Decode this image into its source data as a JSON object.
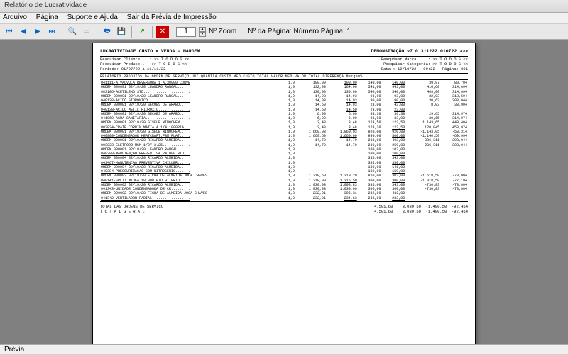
{
  "window": {
    "title": "Relatório de Lucratividade"
  },
  "menu": {
    "items": [
      "Arquivo",
      "Página",
      "Suporte e Ajuda",
      "Sair da Prévia de Impressão"
    ]
  },
  "toolbar": {
    "zoom_value": "1",
    "zoom_label": "Nº Zoom",
    "page_label": "Nº da Página: Número Página: 1"
  },
  "status": {
    "text": "Prévia"
  },
  "report": {
    "title_left": "LUCRATIVIDADE  CUSTO x VENDA = MARGEM",
    "title_right": "DEMONSTRAÇÃO v7.0 311222 010722 >>>",
    "filter_client_lbl": "Pesquisar Cliente... : >> T O D O S <<",
    "filter_prod_lbl": "Pesquisar Produto.. : >> T O D O S <<",
    "filter_marca_lbl": "Pesquisar Marca.... : >> T O D O S <<",
    "filter_cat_lbl": "Pesquisar Categoria: >> T O D O S <<",
    "period": "Período: 01/07/22 à 11/11/22",
    "printed": "Data : 12/10/22 - 09:22",
    "page": "Página: 001",
    "col_header": "RELATÓRIO PRODUTOS DA ORDEM DE SERVIÇO   UNI QUANTIA CUSTO MED  CUSTO TOTAL VALOR MED   VALOR TOTAL  DIFERENÇA Margem%",
    "rows": [
      {
        "t": "i",
        "c": "041111-A VALVULA REVERSORA 1 A.30000 CONVE",
        "u": "1,0",
        "q": "100,00",
        "cm": "100,00",
        "ct": "140,00",
        "vm": "",
        "vt": "140,00",
        "d": "39,97",
        "m": "80,704"
      },
      {
        "t": "o",
        "c": "ORDEM  000001  02/19/20  LEANDRO RANGAL",
        "u": "1,0",
        "q": "132,00",
        "cm": "164,00",
        "ct": "541,00",
        "vm": "",
        "vt": "941,00",
        "d": "416,60",
        "m": "314,094"
      },
      {
        "t": "i",
        "c": "003186-ACETILENO STD",
        "u": "1,0",
        "q": "130,00",
        "cm": "130,00",
        "ct": "540,00",
        "vm": "",
        "vt": "540,00",
        "d": "409,00",
        "m": "314,094"
      },
      {
        "t": "o",
        "c": "ORDEM  000001  02/19/20  LEANDRO RANGAL",
        "u": "1,0",
        "q": "14,93",
        "cm": "14,93",
        "ct": "93,00",
        "vm": "",
        "vt": "93,00",
        "d": "32,93",
        "m": "313,594"
      },
      {
        "t": "i",
        "c": "040138-ACIDO SIDRONICO",
        "u": "1,0",
        "q": "14,93",
        "cm": "14,93",
        "ct": "90,00",
        "vm": "",
        "vt": "90,00",
        "d": "30,63",
        "m": "303,044"
      },
      {
        "t": "o",
        "c": "ORDEM  000001  02/19/20  SECOES DE ARABO",
        "u": "1,0",
        "q": "14,50",
        "cm": "14,93",
        "ct": "23,00",
        "vm": "",
        "vt": "43,00",
        "d": "8,03",
        "m": "38,904"
      },
      {
        "t": "i",
        "c": "040138-ACIDO METIL HIDROXIO",
        "u": "1,0",
        "q": "14,50",
        "cm": "14,50",
        "ct": "23,00",
        "vm": "",
        "vt": "23,00",
        "d": "",
        "m": ""
      },
      {
        "t": "o",
        "c": "ORDEM  000001  02/19/20  SECOES DE ARABO",
        "u": "1,0",
        "q": "6,00",
        "cm": "6,00",
        "ct": "33,30",
        "vm": "",
        "vt": "36,30",
        "d": "29,65",
        "m": "314,974"
      },
      {
        "t": "i",
        "c": "041069-AGUA SANITARIA",
        "u": "1,0",
        "q": "6,00",
        "cm": "6,00",
        "ct": "33,00",
        "vm": "",
        "vt": "33,00",
        "d": "30,65",
        "m": "314,974"
      },
      {
        "t": "o",
        "c": "ORDEM  000001  02/19/20  GISELE WINOCHEM",
        "u": "1,0",
        "q": "3,48",
        "cm": "3,48",
        "ct": "123,50",
        "vm": "",
        "vt": "123,50",
        "d": "1.143,65",
        "m": "449,404"
      },
      {
        "t": "i",
        "c": "003024-CRATE CORBIN MATIA A.1/4 1000P1A",
        "u": "1,0",
        "q": "3,48",
        "cm": "3,48",
        "ct": "123,30",
        "vm": "",
        "vt": "123,50",
        "d": "120,045",
        "m": "450,974"
      },
      {
        "t": "o",
        "c": "ORDEM  000001  02/19/20  GISELE WINOCHEM",
        "u": "1,0",
        "q": "1.660,03",
        "cm": "1.960,03",
        "ct": "920,00",
        "vm": "",
        "vt": "920,00",
        "d": "-1.143,05",
        "m": "-58,314"
      },
      {
        "t": "i",
        "c": "040909-CONDENSADOR HEATCRAFT.FBM FLAT.",
        "u": "1,0",
        "q": "1.660,50",
        "cm": "1.660,00",
        "ct": "930,00",
        "vm": "",
        "vt": "500,00",
        "d": "-1.140,50",
        "m": "-69,994"
      },
      {
        "t": "o",
        "c": "ORDEM  000001  02/19/20  RICARDO ALMEIDA",
        "u": "1,0",
        "q": "14,70",
        "cm": "14,70",
        "ct": "233,00",
        "vm": "",
        "vt": "403,00",
        "d": "336,311",
        "m": "303,044"
      },
      {
        "t": "i",
        "c": "003033-ELETRODO MGM 1/9\" 3.25",
        "u": "1,0",
        "q": "14,70",
        "cm": "14,70",
        "ct": "230,00",
        "vm": "",
        "vt": "250,00",
        "d": "236,311",
        "m": "303,044"
      },
      {
        "t": "o",
        "c": "ORDEM  000001  02/19/20  LEANDRO RANGAL",
        "u": "1,0",
        "q": "",
        "cm": "",
        "ct": "100,00",
        "vm": "",
        "vt": "103,00",
        "d": "",
        "m": ""
      },
      {
        "t": "i",
        "c": "040388-MANUTENÇÃO PREVENTIVA 24.000 BTU",
        "u": "1,0",
        "q": "",
        "cm": "",
        "ct": "100,00",
        "vm": "",
        "vt": "100,00",
        "d": "",
        "m": ""
      },
      {
        "t": "o",
        "c": "ORDEM  000004  02/19/20  RICARDO ALMEIDA",
        "u": "1,0",
        "q": "",
        "cm": "",
        "ct": "335,00",
        "vm": "",
        "vt": "343,00",
        "d": "",
        "m": ""
      },
      {
        "t": "i",
        "c": "043467-MANUTENÇÃO PREVENTIVA CHILLER",
        "u": "1,0",
        "q": "",
        "cm": "",
        "ct": "335,00",
        "vm": "",
        "vt": "350,00",
        "d": "",
        "m": ""
      },
      {
        "t": "o",
        "c": "ORDEM  000004  02/19/20  RICARDO ALMEIDA",
        "u": "1,0",
        "q": "",
        "cm": "",
        "ct": "130,00",
        "vm": "",
        "vt": "141,00",
        "d": "",
        "m": ""
      },
      {
        "t": "i",
        "c": "040384-PRESSURIZAÇÃO COM NITROGÊNIO",
        "u": "1,0",
        "q": "",
        "cm": "",
        "ct": "150,00",
        "vm": "",
        "vt": "150,00",
        "d": "",
        "m": ""
      },
      {
        "t": "o",
        "c": "ORDEM  000002  02/19/20  FICHA DE ALMEIDA JOCA CHAVES",
        "u": "1,0",
        "q": "1.318,50",
        "cm": "1.319,20",
        "ct": "820,00",
        "vm": "",
        "vt": "303,00",
        "d": "-1.518,50",
        "m": "-73,004"
      },
      {
        "t": "i",
        "c": "040141-SPLIT MIDEA 18.000 BTU HI FRIO",
        "u": "1,0",
        "q": "1.318,00",
        "cm": "1.315,50",
        "ct": "300,00",
        "vm": "",
        "vt": "300,00",
        "d": "-1.018,50",
        "m": "-77,194"
      },
      {
        "t": "o",
        "c": "ORDEM  000002  02/19/20  RICARDO ALMEIDA",
        "u": "1,0",
        "q": "1.030,03",
        "cm": "1.098,83",
        "ct": "335,00",
        "vm": "",
        "vt": "343,00",
        "d": "-730,83",
        "m": "-73,004"
      },
      {
        "t": "i",
        "c": "041343-UNIDADE CONDENSADORA DE CR",
        "u": "1,0",
        "q": "1.030,83",
        "cm": "1.030,00",
        "ct": "305,00",
        "vm": "",
        "vt": "300,00",
        "d": "-730,83",
        "m": "-73,004"
      },
      {
        "t": "o",
        "c": "ORDEM  000002  02/19/20  FICHA DE ALMEIDA JOCA CHAVES",
        "u": "1,0",
        "q": "232,01",
        "cm": "306,31",
        "ct": "232,00",
        "vm": "",
        "vt": "432,00",
        "d": "",
        "m": ""
      },
      {
        "t": "i",
        "c": "041342-VENTILADOR RADIAL",
        "u": "1,0",
        "q": "232,01",
        "cm": "234,63",
        "ct": "233,00",
        "vm": "",
        "vt": "233,00",
        "d": "",
        "m": ""
      }
    ],
    "totals": [
      {
        "label": "TOTAL DAS ORDENS DE SERVIÇO",
        "c1": "4.501,60",
        "c2": "3.039,50",
        "c3": "-1.490,50",
        "c4": "-92,454"
      },
      {
        "label": "T O T A L   G E R A L",
        "c1": "4.501,60",
        "c2": "3.039,50",
        "c3": "-1.490,50",
        "c4": "-92,454"
      }
    ]
  }
}
